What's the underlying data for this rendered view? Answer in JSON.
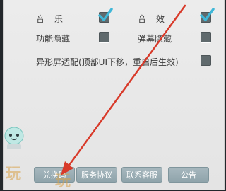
{
  "settings": {
    "music_label": "音乐",
    "sfx_label": "音效",
    "hide_features_label": "功能隐藏",
    "hide_danmaku_label": "弹幕隐藏",
    "notch_label": "异形屏适配(顶部UI下移，重启后生效)",
    "music_checked": true,
    "sfx_checked": true
  },
  "buttons": {
    "account": "兑换码",
    "agreement": "服务协议",
    "support": "联系客服",
    "notice": "公告"
  },
  "watermark": "玩 玩",
  "colors": {
    "panel": "#ececec",
    "checkbox": "#606a6d",
    "check": "#3fb7d8",
    "button": "#9fb1b7",
    "arrow": "#d83a2a"
  }
}
